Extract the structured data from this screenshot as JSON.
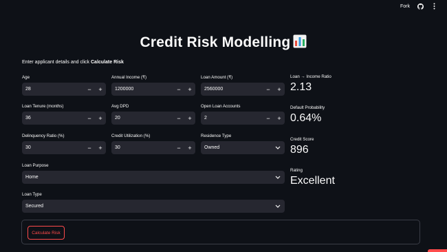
{
  "toolbar": {
    "fork_label": "Fork"
  },
  "page": {
    "title": "Credit Risk Modelling",
    "title_emoji": "📊",
    "intro_prefix": "Enter applicant details and click ",
    "intro_bold": "Calculate Risk"
  },
  "fields": {
    "age": {
      "label": "Age",
      "value": "28"
    },
    "annual_income": {
      "label": "Annual Income (₹)",
      "value": "1200000"
    },
    "loan_amount": {
      "label": "Loan Amount (₹)",
      "value": "2560000"
    },
    "loan_tenure": {
      "label": "Loan Tenure (months)",
      "value": "36"
    },
    "avg_dpd": {
      "label": "Avg DPD",
      "value": "20"
    },
    "open_loan_accounts": {
      "label": "Open Loan Accounts",
      "value": "2"
    },
    "delinquency_ratio": {
      "label": "Delinquency Ratio (%)",
      "value": "30"
    },
    "credit_utilization": {
      "label": "Credit Utilization (%)",
      "value": "30"
    },
    "residence_type": {
      "label": "Residence Type",
      "value": "Owned"
    },
    "loan_purpose": {
      "label": "Loan Purpose",
      "value": "Home"
    },
    "loan_type": {
      "label": "Loan Type",
      "value": "Secured"
    }
  },
  "stepper": {
    "minus": "−",
    "plus": "+"
  },
  "metrics": {
    "ratio": {
      "label": "Loan → Income Ratio",
      "value": "2.13"
    },
    "probability": {
      "label": "Default Probability",
      "value": "0.64%"
    },
    "score": {
      "label": "Credit Score",
      "value": "896"
    },
    "rating": {
      "label": "Rating",
      "value": "Excellent"
    }
  },
  "form": {
    "submit_label": "Calculate Risk"
  },
  "colors": {
    "background": "#0e1117",
    "input": "#262730",
    "accent": "#ff4b4b",
    "text": "#fafafa"
  }
}
